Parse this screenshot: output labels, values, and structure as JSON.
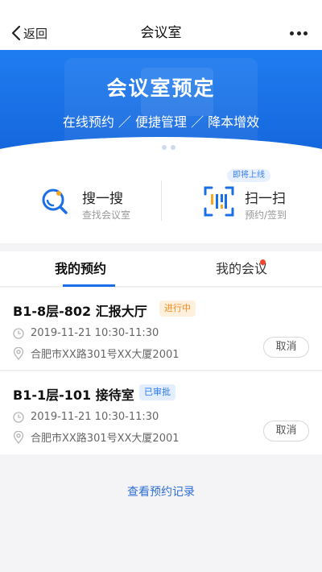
{
  "nav": {
    "back_label": "返回",
    "title": "会议室"
  },
  "banner": {
    "title": "会议室预定",
    "subtitle": "在线预约 ／ 便捷管理 ／ 降本增效",
    "slide_count": 3,
    "active_slide": 1
  },
  "quick_actions": {
    "search": {
      "title": "搜一搜",
      "subtitle": "查找会议室"
    },
    "scan": {
      "title": "扫一扫",
      "subtitle": "预约/签到",
      "badge": "即将上线"
    }
  },
  "tabs": [
    {
      "label": "我的预约",
      "active": true
    },
    {
      "label": "我的会议",
      "active": false,
      "has_dot": true
    }
  ],
  "reservations": [
    {
      "room": "B1-8层-802 汇报大厅",
      "status": "进行中",
      "time": "2019-11-21 10:30-11:30",
      "location": "合肥市XX路301号XX大厦2001",
      "action": "取消"
    },
    {
      "room": "B1-1层-101 接待室",
      "status": "已审批",
      "time": "2019-11-21 10:30-11:30",
      "location": "合肥市XX路301号XX大厦2001",
      "action": "取消"
    }
  ],
  "footer": {
    "records_link": "查看预约记录"
  },
  "colors": {
    "primary": "#1a6fe8",
    "banner_top": "#1f7df0",
    "banner_bottom": "#1565dc",
    "status_progress_bg": "#fff0de",
    "status_progress_fg": "#f08a1c",
    "status_approved_bg": "#e3eeff",
    "status_approved_fg": "#2f7af0",
    "tab_dot": "#f0452d",
    "accent_orange": "#f5a623"
  },
  "icons": {
    "back": "chevron-left-icon",
    "more": "more-dots-icon",
    "search": "search-magnifier-icon",
    "scan": "qr-scan-icon",
    "time": "clock-icon",
    "location": "location-pin-icon"
  }
}
